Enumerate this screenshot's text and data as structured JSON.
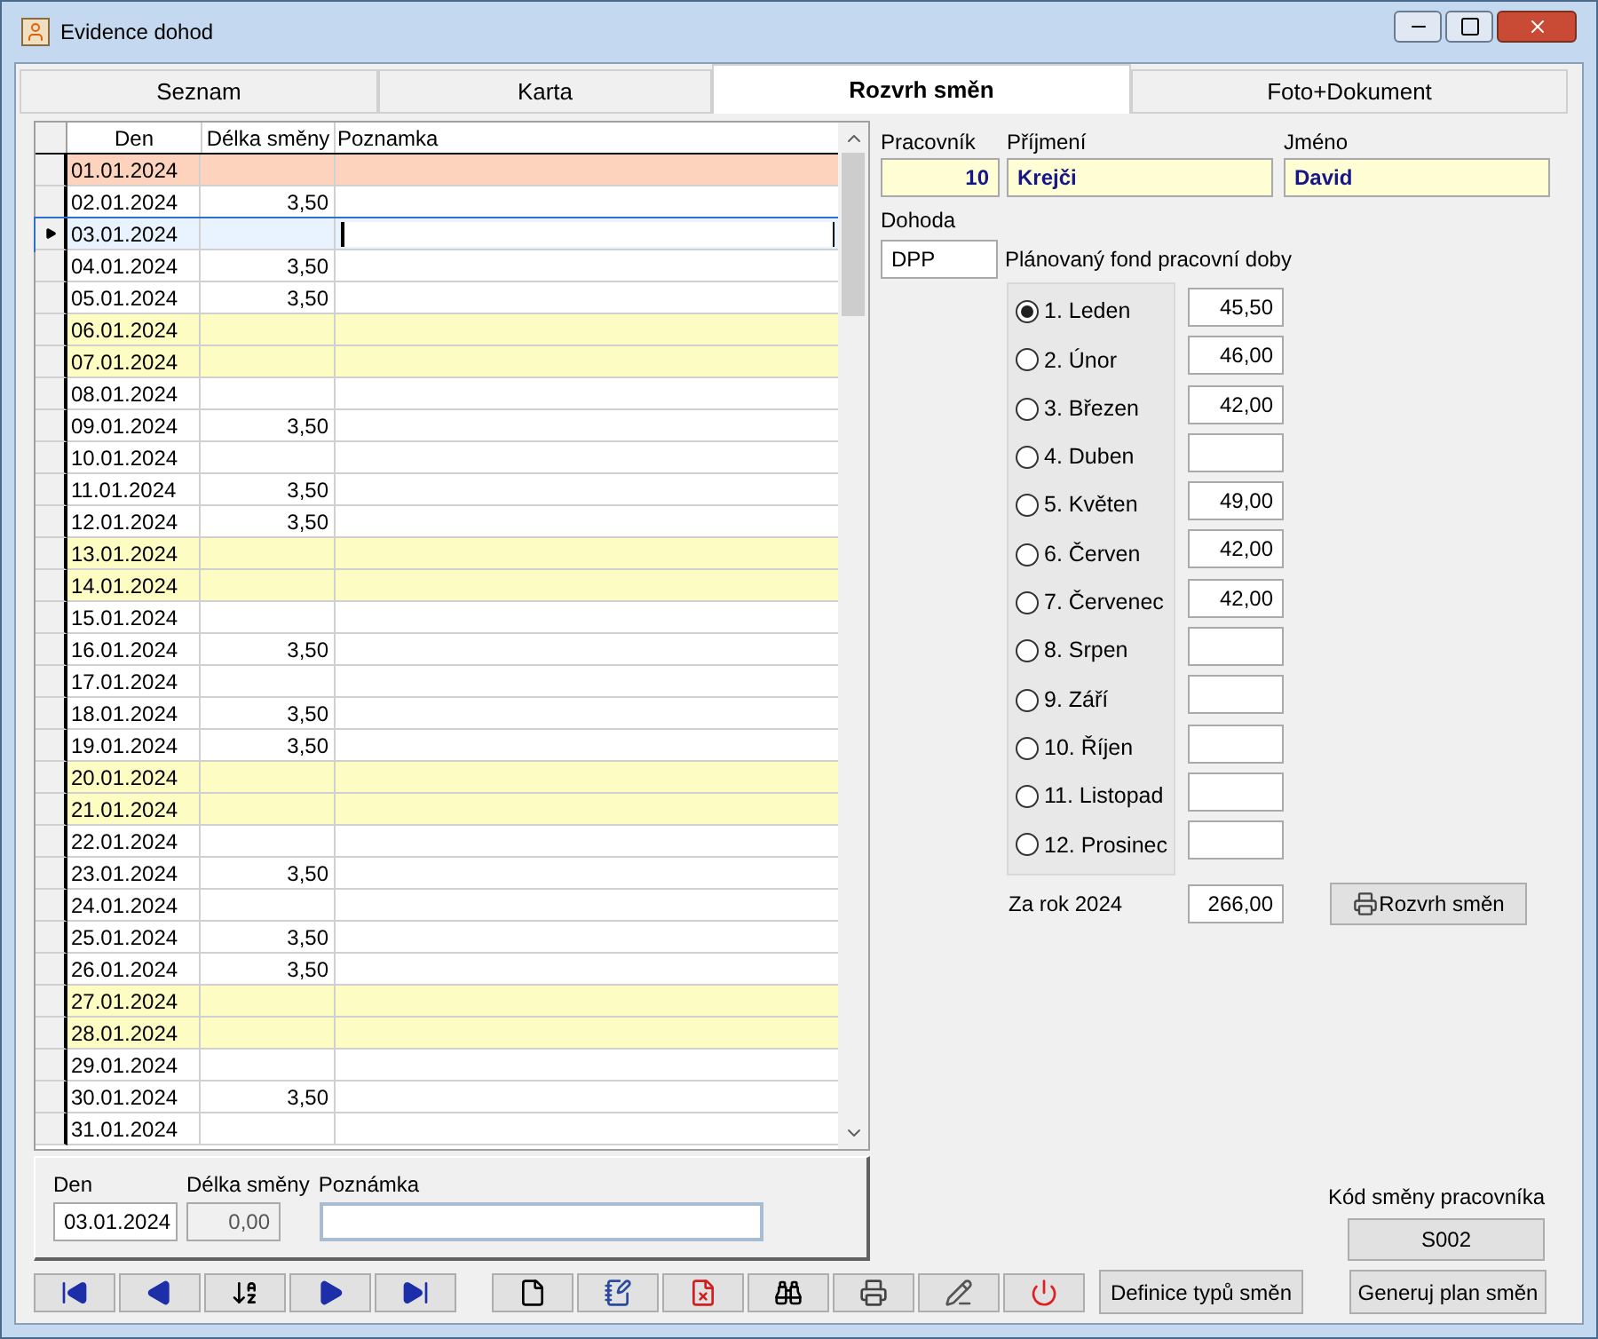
{
  "window": {
    "title": "Evidence dohod"
  },
  "tabs": [
    {
      "label": "Seznam",
      "selected": false
    },
    {
      "label": "Karta",
      "selected": false
    },
    {
      "label": "Rozvrh směn",
      "selected": true
    },
    {
      "label": "Foto+Dokument",
      "selected": false
    }
  ],
  "grid": {
    "columns": [
      "Den",
      "Délka směny",
      "Poznamka"
    ],
    "rows": [
      {
        "den": "01.01.2024",
        "kind": "holiday",
        "selected": false
      },
      {
        "den": "02.01.2024",
        "delka": "3,50",
        "kind": "workday",
        "selected": false
      },
      {
        "den": "03.01.2024",
        "kind": "workday",
        "selected": true
      },
      {
        "den": "04.01.2024",
        "delka": "3,50",
        "kind": "workday",
        "selected": false
      },
      {
        "den": "05.01.2024",
        "delka": "3,50",
        "kind": "workday",
        "selected": false
      },
      {
        "den": "06.01.2024",
        "kind": "weekend",
        "selected": false
      },
      {
        "den": "07.01.2024",
        "kind": "weekend",
        "selected": false
      },
      {
        "den": "08.01.2024",
        "kind": "workday",
        "selected": false
      },
      {
        "den": "09.01.2024",
        "delka": "3,50",
        "kind": "workday",
        "selected": false
      },
      {
        "den": "10.01.2024",
        "kind": "workday",
        "selected": false
      },
      {
        "den": "11.01.2024",
        "delka": "3,50",
        "kind": "workday",
        "selected": false
      },
      {
        "den": "12.01.2024",
        "delka": "3,50",
        "kind": "workday",
        "selected": false
      },
      {
        "den": "13.01.2024",
        "kind": "weekend",
        "selected": false
      },
      {
        "den": "14.01.2024",
        "kind": "weekend",
        "selected": false
      },
      {
        "den": "15.01.2024",
        "kind": "workday",
        "selected": false
      },
      {
        "den": "16.01.2024",
        "delka": "3,50",
        "kind": "workday",
        "selected": false
      },
      {
        "den": "17.01.2024",
        "kind": "workday",
        "selected": false
      },
      {
        "den": "18.01.2024",
        "delka": "3,50",
        "kind": "workday",
        "selected": false
      },
      {
        "den": "19.01.2024",
        "delka": "3,50",
        "kind": "workday",
        "selected": false
      },
      {
        "den": "20.01.2024",
        "kind": "weekend",
        "selected": false
      },
      {
        "den": "21.01.2024",
        "kind": "weekend",
        "selected": false
      },
      {
        "den": "22.01.2024",
        "kind": "workday",
        "selected": false
      },
      {
        "den": "23.01.2024",
        "delka": "3,50",
        "kind": "workday",
        "selected": false
      },
      {
        "den": "24.01.2024",
        "kind": "workday",
        "selected": false
      },
      {
        "den": "25.01.2024",
        "delka": "3,50",
        "kind": "workday",
        "selected": false
      },
      {
        "den": "26.01.2024",
        "delka": "3,50",
        "kind": "workday",
        "selected": false
      },
      {
        "den": "27.01.2024",
        "kind": "weekend",
        "selected": false
      },
      {
        "den": "28.01.2024",
        "kind": "weekend",
        "selected": false
      },
      {
        "den": "29.01.2024",
        "kind": "workday",
        "selected": false
      },
      {
        "den": "30.01.2024",
        "delka": "3,50",
        "kind": "workday",
        "selected": false
      },
      {
        "den": "31.01.2024",
        "kind": "workday",
        "selected": false
      }
    ]
  },
  "employee": {
    "pracovnik_label": "Pracovník",
    "pracovnik": "10",
    "prijmeni_label": "Příjmení",
    "prijmeni": "Krejči",
    "jmeno_label": "Jméno",
    "jmeno": "David",
    "dohoda_label": "Dohoda",
    "dohoda": "DPP"
  },
  "fund": {
    "title": "Plánovaný fond pracovní doby",
    "months": [
      {
        "label": "1. Leden",
        "value": "45,50",
        "selected": true
      },
      {
        "label": "2. Únor",
        "value": "46,00",
        "selected": false
      },
      {
        "label": "3. Březen",
        "value": "42,00",
        "selected": false
      },
      {
        "label": "4. Duben",
        "selected": false
      },
      {
        "label": "5. Květen",
        "value": "49,00",
        "selected": false
      },
      {
        "label": "6. Červen",
        "value": "42,00",
        "selected": false
      },
      {
        "label": "7. Červenec",
        "value": "42,00",
        "selected": false
      },
      {
        "label": "8. Srpen",
        "selected": false
      },
      {
        "label": "9. Září",
        "selected": false
      },
      {
        "label": "10. Říjen",
        "selected": false
      },
      {
        "label": "11. Listopad",
        "selected": false
      },
      {
        "label": "12. Prosinec",
        "selected": false
      }
    ],
    "total_label": "Za rok 2024",
    "total": "266,00",
    "print_button": "Rozvrh směn"
  },
  "detail": {
    "den_label": "Den",
    "den": "03.01.2024",
    "delka_label": "Délka směny",
    "delka": "0,00",
    "poznamka_label": "Poznámka"
  },
  "shift_code": {
    "label": "Kód směny pracovníka",
    "value": "S002"
  },
  "buttons": [
    "Definice typů směn",
    "Generuj plan směn"
  ]
}
